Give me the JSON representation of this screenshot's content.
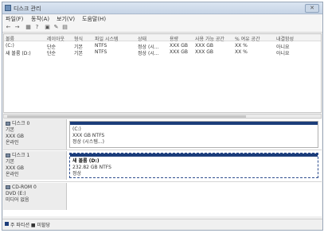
{
  "window": {
    "title": "디스크 관리",
    "close_label": "✕"
  },
  "menu": [
    "파일(F)",
    "동작(A)",
    "보기(V)",
    "도움말(H)"
  ],
  "toolbar": {
    "buttons": [
      "←",
      "→",
      "▦",
      "?",
      "▣",
      "✎",
      "▤"
    ]
  },
  "table": {
    "columns": [
      "볼륨",
      "레이아웃",
      "형식",
      "파일 시스템",
      "상태",
      "용량",
      "사용 가능 공간",
      "% 여유 공간",
      "내결함성"
    ],
    "rows": [
      [
        "(C:)",
        "단순",
        "기본",
        "NTFS",
        "정상 (시...",
        "XXX GB",
        "XXX GB",
        "XX %",
        "아니요"
      ],
      [
        "새 볼륨 (D:)",
        "단순",
        "기본",
        "NTFS",
        "정상 (시...",
        "XXX GB",
        "XXX GB",
        "XX %",
        "아니요"
      ]
    ]
  },
  "disks": [
    {
      "name": "디스크 0",
      "type": "기본",
      "size": "XXX GB",
      "status": "온라인",
      "partition": {
        "label": "(C:)",
        "size_fs": "XXX GB NTFS",
        "status": "정상 (시스템...)"
      }
    },
    {
      "name": "디스크 1",
      "type": "기본",
      "size": "XXX GB",
      "status": "온라인",
      "partition": {
        "label": "새 볼륨  (D:)",
        "size_fs": "232.82 GB NTFS",
        "status": "정상"
      }
    },
    {
      "name": "CD-ROM 0",
      "type": "DVD (E:)",
      "size": "",
      "status": "미디어 없음",
      "partition": null
    }
  ],
  "legend": {
    "label": "주 파티션",
    "swatch_color": "#1c3d7a",
    "text": "주 파티션  ■ 미할당"
  }
}
